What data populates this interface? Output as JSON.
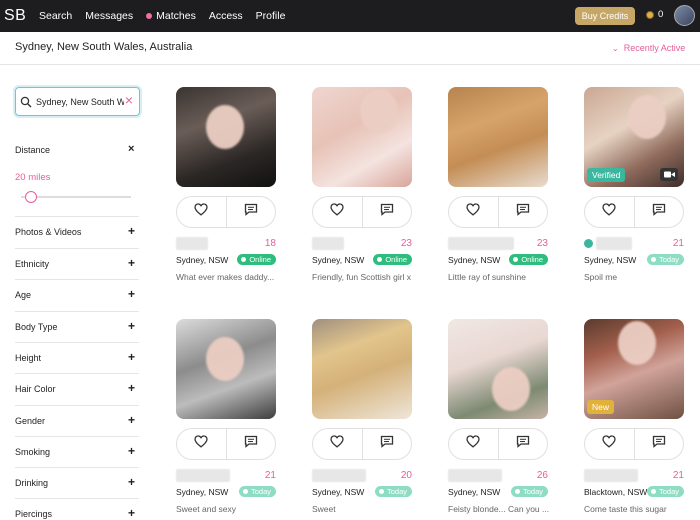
{
  "app": {
    "logo": "SB"
  },
  "nav": {
    "items": [
      {
        "label": "Search"
      },
      {
        "label": "Messages"
      },
      {
        "label": "Matches"
      },
      {
        "label": "Access"
      },
      {
        "label": "Profile"
      }
    ],
    "buy_credits": "Buy Credits",
    "credits": "0"
  },
  "location_title": "Sydney, New South Wales, Australia",
  "sort_label": "Recently Active",
  "search": {
    "value": "Sydney, New South W"
  },
  "filters": {
    "distance": {
      "label": "Distance",
      "value": "20 miles",
      "slider_fraction": 0.07
    },
    "items": [
      {
        "label": "Photos & Videos"
      },
      {
        "label": "Ethnicity"
      },
      {
        "label": "Age"
      },
      {
        "label": "Body Type"
      },
      {
        "label": "Height"
      },
      {
        "label": "Hair Color"
      },
      {
        "label": "Gender"
      },
      {
        "label": "Smoking"
      },
      {
        "label": "Drinking"
      },
      {
        "label": "Piercings"
      }
    ]
  },
  "profiles": [
    {
      "age": "18",
      "location": "Sydney, NSW",
      "status": "Online",
      "tagline": "What ever makes daddy..."
    },
    {
      "age": "23",
      "location": "Sydney, NSW",
      "status": "Online",
      "tagline": "Friendly, fun Scottish girl x"
    },
    {
      "age": "23",
      "location": "Sydney, NSW",
      "status": "Online",
      "tagline": "Little ray of sunshine"
    },
    {
      "age": "21",
      "location": "Sydney, NSW",
      "status": "Today",
      "tagline": "Spoil me",
      "photo_tag": "Verified"
    },
    {
      "age": "21",
      "location": "Sydney, NSW",
      "status": "Today",
      "tagline": "Sweet and sexy"
    },
    {
      "age": "20",
      "location": "Sydney, NSW",
      "status": "Today",
      "tagline": "Sweet"
    },
    {
      "age": "26",
      "location": "Sydney, NSW",
      "status": "Today",
      "tagline": "Feisty blonde... Can you ..."
    },
    {
      "age": "21",
      "location": "Blacktown, NSW",
      "status": "Today",
      "tagline": "Come taste this sugar",
      "photo_tag": "New"
    }
  ]
}
